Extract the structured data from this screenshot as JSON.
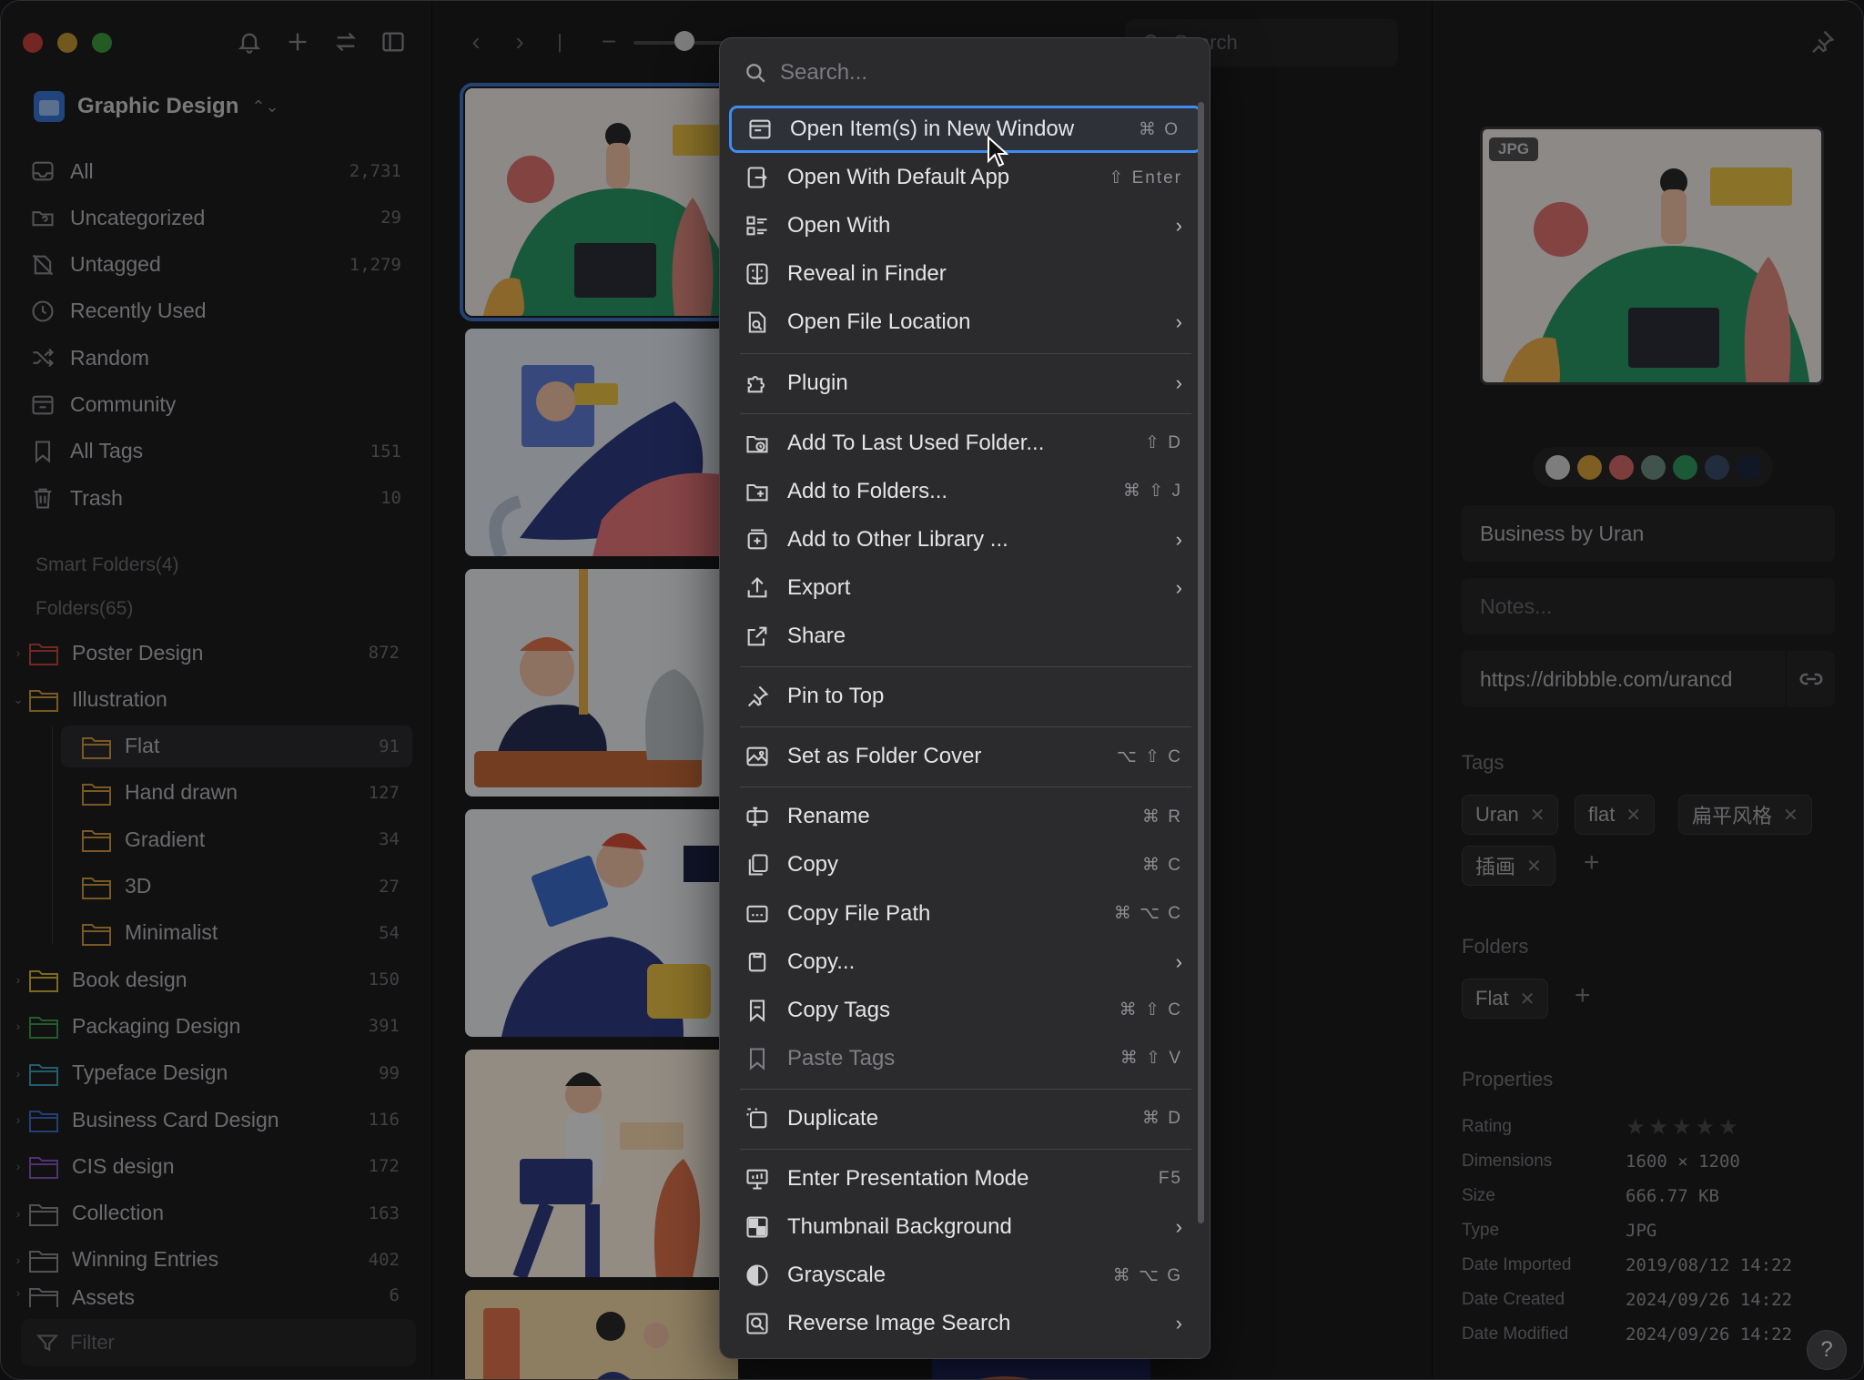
{
  "library": {
    "name": "Graphic Design"
  },
  "nav": [
    {
      "label": "All",
      "count": "2,731",
      "icon": "inbox-icon"
    },
    {
      "label": "Uncategorized",
      "count": "29",
      "icon": "folder-question-icon"
    },
    {
      "label": "Untagged",
      "count": "1,279",
      "icon": "tag-off-icon"
    },
    {
      "label": "Recently Used",
      "count": "",
      "icon": "clock-icon"
    },
    {
      "label": "Random",
      "count": "",
      "icon": "shuffle-icon"
    },
    {
      "label": "Community",
      "count": "",
      "icon": "community-icon"
    },
    {
      "label": "All Tags",
      "count": "151",
      "icon": "bookmark-icon"
    },
    {
      "label": "Trash",
      "count": "10",
      "icon": "trash-icon"
    }
  ],
  "smart_folders_label": "Smart Folders(4)",
  "folders_label": "Folders(65)",
  "folders": [
    {
      "label": "Poster Design",
      "count": "872",
      "color": "#c9453f",
      "arrow": "›",
      "indent": 0
    },
    {
      "label": "Illustration",
      "count": "",
      "color": "#d19a3c",
      "arrow": "⌄",
      "indent": 0
    },
    {
      "label": "Flat",
      "count": "91",
      "color": "#d19a3c",
      "arrow": "",
      "indent": 1,
      "selected": true
    },
    {
      "label": "Hand drawn",
      "count": "127",
      "color": "#d19a3c",
      "arrow": "",
      "indent": 1
    },
    {
      "label": "Gradient",
      "count": "34",
      "color": "#d19a3c",
      "arrow": "",
      "indent": 1
    },
    {
      "label": "3D",
      "count": "27",
      "color": "#d19a3c",
      "arrow": "",
      "indent": 1
    },
    {
      "label": "Minimalist",
      "count": "54",
      "color": "#d19a3c",
      "arrow": "",
      "indent": 1
    },
    {
      "label": "Book design",
      "count": "150",
      "color": "#d9b43a",
      "arrow": "›",
      "indent": 0
    },
    {
      "label": "Packaging Design",
      "count": "391",
      "color": "#3f9b4c",
      "arrow": "›",
      "indent": 0
    },
    {
      "label": "Typeface Design",
      "count": "99",
      "color": "#3aa0b8",
      "arrow": "›",
      "indent": 0
    },
    {
      "label": "Business Card Design",
      "count": "116",
      "color": "#3a6fc9",
      "arrow": "›",
      "indent": 0
    },
    {
      "label": "CIS design",
      "count": "172",
      "color": "#8a55c4",
      "arrow": "›",
      "indent": 0
    },
    {
      "label": "Collection",
      "count": "163",
      "color": "#8d8d91",
      "arrow": "›",
      "indent": 0
    },
    {
      "label": "Winning Entries",
      "count": "402",
      "color": "#8d8d91",
      "arrow": "›",
      "indent": 0
    },
    {
      "label": "Assets",
      "count": "6",
      "color": "#8d8d91",
      "arrow": "›",
      "indent": 0
    }
  ],
  "filter_placeholder": "Filter",
  "toolbar": {
    "search_placeholder": "Search"
  },
  "menu": {
    "search_placeholder": "Search...",
    "items": [
      {
        "label": "Open Item(s) in New Window",
        "shortcut": "⌘ O",
        "submenu": false,
        "icon": "window-icon",
        "highlight": true
      },
      {
        "label": "Open With Default App",
        "shortcut": "⇧ Enter",
        "submenu": false,
        "icon": "open-app-icon"
      },
      {
        "label": "Open With",
        "shortcut": "",
        "submenu": true,
        "icon": "grid-list-icon"
      },
      {
        "label": "Reveal in Finder",
        "shortcut": "",
        "submenu": false,
        "icon": "finder-icon"
      },
      {
        "label": "Open File Location",
        "shortcut": "",
        "submenu": true,
        "icon": "file-search-icon"
      },
      {
        "label": "Plugin",
        "shortcut": "",
        "submenu": true,
        "icon": "puzzle-icon",
        "sep_before": true
      },
      {
        "label": "Add To Last Used Folder...",
        "shortcut": "⇧ D",
        "submenu": false,
        "icon": "folder-clock-icon",
        "sep_before": true
      },
      {
        "label": "Add to Folders...",
        "shortcut": "⌘ ⇧ J",
        "submenu": false,
        "icon": "folder-add-icon"
      },
      {
        "label": "Add to Other Library ...",
        "shortcut": "",
        "submenu": true,
        "icon": "library-icon"
      },
      {
        "label": "Export",
        "shortcut": "",
        "submenu": true,
        "icon": "export-icon"
      },
      {
        "label": "Share",
        "shortcut": "",
        "submenu": false,
        "icon": "share-icon"
      },
      {
        "label": "Pin to Top",
        "shortcut": "",
        "submenu": false,
        "icon": "pin-icon",
        "sep_before": true
      },
      {
        "label": "Set as Folder Cover",
        "shortcut": "⌥ ⇧ C",
        "submenu": false,
        "icon": "image-icon",
        "sep_before": true
      },
      {
        "label": "Rename",
        "shortcut": "⌘ R",
        "submenu": false,
        "icon": "rename-icon",
        "sep_before": true
      },
      {
        "label": "Copy",
        "shortcut": "⌘ C",
        "submenu": false,
        "icon": "copy-icon"
      },
      {
        "label": "Copy File Path",
        "shortcut": "⌘ ⌥ C",
        "submenu": false,
        "icon": "path-icon"
      },
      {
        "label": "Copy...",
        "shortcut": "",
        "submenu": true,
        "icon": "copy-more-icon"
      },
      {
        "label": "Copy Tags",
        "shortcut": "⌘ ⇧ C",
        "submenu": false,
        "icon": "copy-tag-icon"
      },
      {
        "label": "Paste Tags",
        "shortcut": "⌘ ⇧ V",
        "submenu": false,
        "icon": "paste-tag-icon",
        "disabled": true
      },
      {
        "label": "Duplicate",
        "shortcut": "⌘ D",
        "submenu": false,
        "icon": "duplicate-icon",
        "sep_before": true
      },
      {
        "label": "Enter Presentation Mode",
        "shortcut": "F5",
        "submenu": false,
        "icon": "presentation-icon",
        "sep_before": true
      },
      {
        "label": "Thumbnail Background",
        "shortcut": "",
        "submenu": true,
        "icon": "checker-icon"
      },
      {
        "label": "Grayscale",
        "shortcut": "⌘ ⌥ G",
        "submenu": false,
        "icon": "contrast-icon"
      },
      {
        "label": "Reverse Image Search",
        "shortcut": "",
        "submenu": true,
        "icon": "reverse-search-icon"
      }
    ]
  },
  "inspector": {
    "ext": "JPG",
    "swatches": [
      "#d8d8d8",
      "#d9a33a",
      "#d96a6a",
      "#6f8f86",
      "#2f9a5f",
      "#3a4f6b",
      "#1e2a40"
    ],
    "title": "Business by Uran",
    "notes_placeholder": "Notes...",
    "url": "https://dribbble.com/urancd",
    "tags_label": "Tags",
    "tags": [
      "Uran",
      "flat",
      "扁平风格",
      "插画"
    ],
    "folders_label": "Folders",
    "folders": [
      "Flat"
    ],
    "properties_label": "Properties",
    "properties": [
      {
        "k": "Rating",
        "v": ""
      },
      {
        "k": "Dimensions",
        "v": "1600 × 1200"
      },
      {
        "k": "Size",
        "v": "666.77 KB"
      },
      {
        "k": "Type",
        "v": "JPG"
      },
      {
        "k": "Date Imported",
        "v": "2019/08/12 14:22"
      },
      {
        "k": "Date Created",
        "v": "2024/09/26 14:22"
      },
      {
        "k": "Date Modified",
        "v": "2024/09/26 14:22"
      }
    ]
  },
  "help_label": "?"
}
